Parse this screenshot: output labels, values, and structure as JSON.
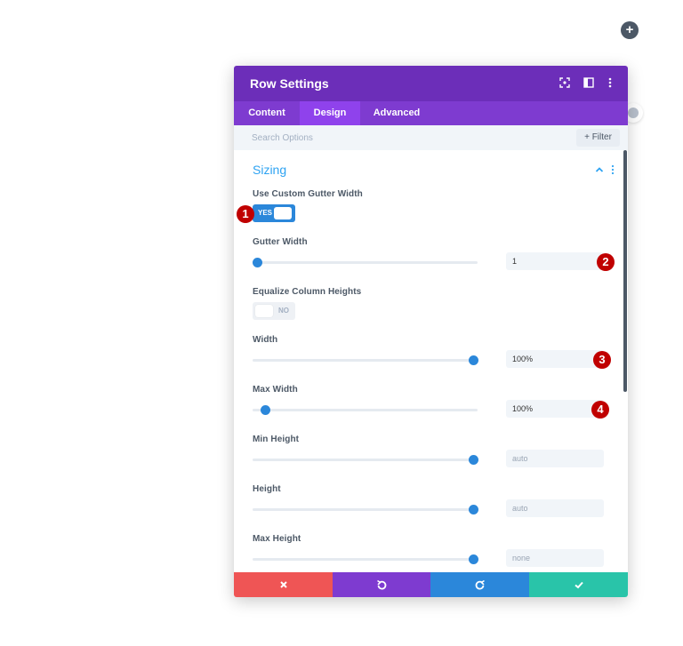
{
  "modal": {
    "title": "Row Settings",
    "tabs": [
      {
        "label": "Content",
        "active": false
      },
      {
        "label": "Design",
        "active": true
      },
      {
        "label": "Advanced",
        "active": false
      }
    ],
    "search": {
      "placeholder": "Search Options"
    },
    "filter_label": "+ Filter"
  },
  "section": {
    "title": "Sizing",
    "use_custom_gutter": {
      "label": "Use Custom Gutter Width",
      "value": "YES"
    },
    "gutter_width": {
      "label": "Gutter Width",
      "value": "1"
    },
    "equalize": {
      "label": "Equalize Column Heights",
      "value": "NO"
    },
    "width": {
      "label": "Width",
      "value": "100%"
    },
    "max_width": {
      "label": "Max Width",
      "value": "100%"
    },
    "min_height": {
      "label": "Min Height",
      "value": "auto"
    },
    "height": {
      "label": "Height",
      "value": "auto"
    },
    "max_height": {
      "label": "Max Height",
      "value": "none"
    }
  },
  "callouts": [
    "1",
    "2",
    "3",
    "4"
  ],
  "colors": {
    "header": "#6c2eb9",
    "tabs": "#7e3bd0",
    "accent": "#2b87da",
    "section_title": "#2ea3f2",
    "cancel": "#ef5555",
    "undo": "#7e3bd0",
    "redo": "#2b87da",
    "save": "#29c4a9",
    "callout": "#c00000"
  },
  "icons": {
    "fullscreen": "fullscreen-icon",
    "split_view": "split-view-icon",
    "more": "more-vertical-icon",
    "cancel": "close-icon",
    "undo": "undo-icon",
    "redo": "redo-icon",
    "save": "check-icon"
  }
}
